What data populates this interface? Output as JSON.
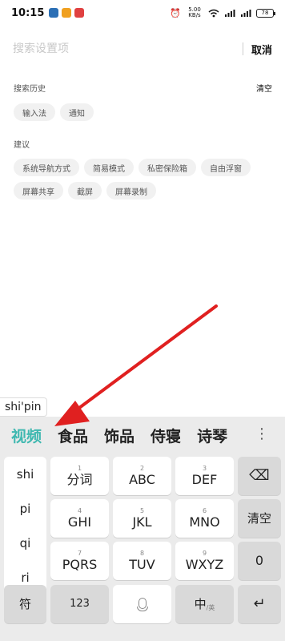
{
  "status_bar": {
    "time": "10:15",
    "app_icons": [
      {
        "name": "app-icon-1",
        "color": "#2b6fb5"
      },
      {
        "name": "app-icon-2",
        "color": "#f0a020"
      },
      {
        "name": "app-icon-3",
        "color": "#e04040"
      }
    ],
    "net_speed": "5.00\nKB/s",
    "battery": "78"
  },
  "search": {
    "placeholder": "搜索设置项",
    "cancel_label": "取消"
  },
  "history": {
    "title": "搜索历史",
    "clear_label": "清空",
    "chips": [
      "输入法",
      "通知"
    ]
  },
  "suggestions": {
    "title": "建议",
    "row1": [
      "系统导航方式",
      "简易模式",
      "私密保险箱",
      "自由浮窗"
    ],
    "row2": [
      "屏幕共享",
      "截屏",
      "屏幕录制"
    ]
  },
  "ime": {
    "pinyin_preview": "shi'pin",
    "candidates": [
      "视频",
      "食品",
      "饰品",
      "侍寝",
      "诗琴"
    ],
    "more_icon": "⋮",
    "pinyin_options": [
      "shi",
      "pi",
      "qi",
      "ri"
    ],
    "keys": {
      "k1": {
        "num": "1",
        "label": "分词"
      },
      "k2": {
        "num": "2",
        "label": "ABC"
      },
      "k3": {
        "num": "3",
        "label": "DEF"
      },
      "k4": {
        "num": "4",
        "label": "GHI"
      },
      "k5": {
        "num": "5",
        "label": "JKL"
      },
      "k6": {
        "num": "6",
        "label": "MNO"
      },
      "k7": {
        "num": "7",
        "label": "PQRS"
      },
      "k8": {
        "num": "8",
        "label": "TUV"
      },
      "k9": {
        "num": "9",
        "label": "WXYZ"
      },
      "clear": "清空",
      "zero": "0",
      "symbol": "符",
      "num_mode": "123",
      "lang": "中",
      "lang_sub": "/英",
      "backspace": "⌫",
      "enter": "↵"
    }
  },
  "colors": {
    "accent_candidate": "#3fb8b0",
    "arrow": "#e02020"
  }
}
